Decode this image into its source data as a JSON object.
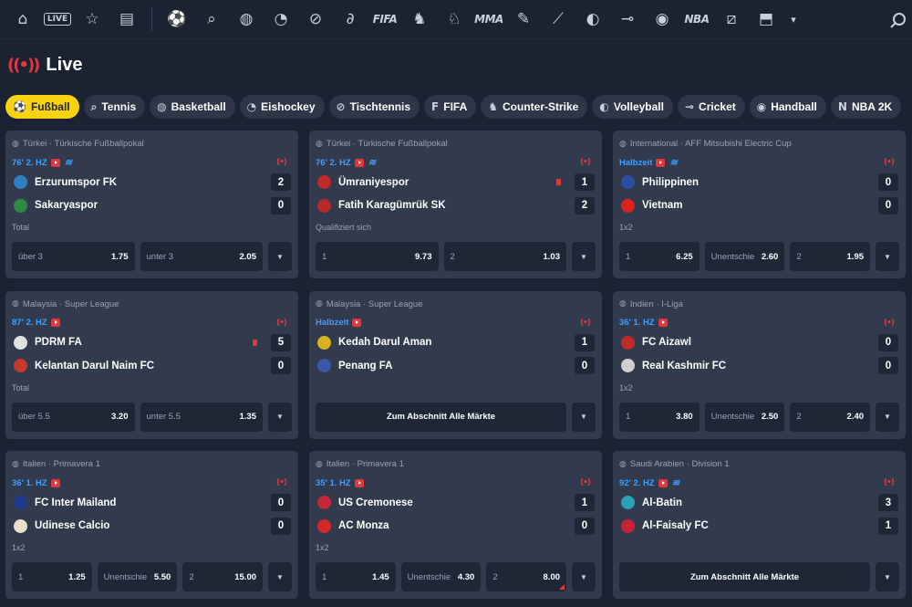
{
  "nav": {
    "items": [
      {
        "name": "home-icon",
        "glyph": "⌂"
      },
      {
        "name": "live-icon",
        "text": "LIVE"
      },
      {
        "name": "star-icon",
        "glyph": "☆"
      },
      {
        "name": "betslip-icon",
        "glyph": "▤"
      },
      {
        "name": "soccer-icon",
        "glyph": "⚽"
      },
      {
        "name": "tennis-icon",
        "glyph": "⌕"
      },
      {
        "name": "basketball-icon",
        "glyph": "◍"
      },
      {
        "name": "ice-hockey-icon",
        "glyph": "◔"
      },
      {
        "name": "table-tennis-icon",
        "glyph": "⊘"
      },
      {
        "name": "hockey-stick-icon",
        "glyph": "∂"
      },
      {
        "name": "fifa-icon",
        "text": "FIFA"
      },
      {
        "name": "counter-strike-icon",
        "glyph": "♞"
      },
      {
        "name": "horse-racing-icon",
        "glyph": "♘"
      },
      {
        "name": "mma-icon",
        "text": "MMA"
      },
      {
        "name": "darts-icon",
        "glyph": "✎"
      },
      {
        "name": "baseball-bat-icon",
        "glyph": "⟋"
      },
      {
        "name": "volleyball-icon",
        "glyph": "◐"
      },
      {
        "name": "badminton-icon",
        "glyph": "⊸"
      },
      {
        "name": "handball-icon",
        "glyph": "◉"
      },
      {
        "name": "nba-2k-icon",
        "text": "NBA"
      },
      {
        "name": "esports-icon",
        "glyph": "⧄"
      },
      {
        "name": "league-icon",
        "glyph": "⬒"
      },
      {
        "name": "more-chevron-icon",
        "glyph": "▾"
      }
    ],
    "search_icon": "search-icon"
  },
  "header": {
    "title": "Live"
  },
  "chips": [
    {
      "label": "Fußball",
      "icon": "soccer-icon",
      "glyph": "⚽",
      "active": true
    },
    {
      "label": "Tennis",
      "icon": "tennis-icon",
      "glyph": "⌕"
    },
    {
      "label": "Basketball",
      "icon": "basketball-icon",
      "glyph": "◍"
    },
    {
      "label": "Eishockey",
      "icon": "ice-hockey-icon",
      "glyph": "◔"
    },
    {
      "label": "Tischtennis",
      "icon": "table-tennis-icon",
      "glyph": "⊘"
    },
    {
      "label": "FIFA",
      "icon": "fifa-icon",
      "glyph": "F"
    },
    {
      "label": "Counter-Strike",
      "icon": "counter-strike-icon",
      "glyph": "♞"
    },
    {
      "label": "Volleyball",
      "icon": "volleyball-icon",
      "glyph": "◐"
    },
    {
      "label": "Cricket",
      "icon": "cricket-icon",
      "glyph": "⊸"
    },
    {
      "label": "Handball",
      "icon": "handball-icon",
      "glyph": "◉"
    },
    {
      "label": "NBA 2K",
      "icon": "nba-2k-icon",
      "glyph": "N"
    }
  ],
  "colors": {
    "accent": "#f7d312",
    "live_red": "#e2383d",
    "time_blue": "#3ea0ff",
    "card_bg": "#323a4d",
    "page_bg": "#1b2232"
  },
  "matches": [
    {
      "league": "Türkei · Türkische Fußballpokal",
      "time": "76' 2. HZ",
      "stats": true,
      "home": {
        "name": "Erzurumspor FK",
        "score": "2",
        "logo": "#2d7fc1"
      },
      "away": {
        "name": "Sakaryaspor",
        "score": "0",
        "logo": "#2f8a45"
      },
      "market": "Total",
      "odds": [
        {
          "label": "über 3",
          "value": "1.75"
        },
        {
          "label": "unter 3",
          "value": "2.05"
        }
      ]
    },
    {
      "league": "Türkei · Türkische Fußballpokal",
      "time": "76' 2. HZ",
      "stats": true,
      "home": {
        "name": "Ümraniyespor",
        "score": "1",
        "logo": "#c0282d",
        "redcard": true
      },
      "away": {
        "name": "Fatih Karagümrük SK",
        "score": "2",
        "logo": "#b52a2a"
      },
      "market": "Qualifiziert sich",
      "odds": [
        {
          "label": "1",
          "value": "9.73"
        },
        {
          "label": "2",
          "value": "1.03"
        }
      ]
    },
    {
      "league": "International · AFF Mitsubishi Electric Cup",
      "time": "Halbzeit",
      "stats": true,
      "home": {
        "name": "Philippinen",
        "score": "0",
        "logo": "#2c4ea3"
      },
      "away": {
        "name": "Vietnam",
        "score": "0",
        "logo": "#d8231f"
      },
      "market": "1x2",
      "odds": [
        {
          "label": "1",
          "value": "6.25"
        },
        {
          "label": "Unentschie",
          "value": "2.60"
        },
        {
          "label": "2",
          "value": "1.95"
        }
      ]
    },
    {
      "league": "Malaysia · Super League",
      "time": "87' 2. HZ",
      "stats": false,
      "home": {
        "name": "PDRM FA",
        "score": "5",
        "logo": "#e0e0e0",
        "redcard": true
      },
      "away": {
        "name": "Kelantan Darul Naim FC",
        "score": "0",
        "logo": "#c43a2b"
      },
      "market": "Total",
      "odds": [
        {
          "label": "über 5.5",
          "value": "3.20"
        },
        {
          "label": "unter 5.5",
          "value": "1.35"
        }
      ]
    },
    {
      "league": "Malaysia · Super League",
      "time": "Halbzeit",
      "stats": false,
      "home": {
        "name": "Kedah Darul Aman",
        "score": "1",
        "logo": "#d9b21f"
      },
      "away": {
        "name": "Penang FA",
        "score": "0",
        "logo": "#3a58a8"
      },
      "market": "",
      "all_markets": "Zum Abschnitt Alle Märkte"
    },
    {
      "league": "Indien · I-Liga",
      "time": "36' 1. HZ",
      "stats": false,
      "home": {
        "name": "FC Aizawl",
        "score": "0",
        "logo": "#c12a2a"
      },
      "away": {
        "name": "Real Kashmir FC",
        "score": "0",
        "logo": "#d0d0d0"
      },
      "market": "1x2",
      "odds": [
        {
          "label": "1",
          "value": "3.80"
        },
        {
          "label": "Unentschie",
          "value": "2.50"
        },
        {
          "label": "2",
          "value": "2.40"
        }
      ]
    },
    {
      "league": "Italien · Primavera 1",
      "time": "36' 1. HZ",
      "stats": false,
      "home": {
        "name": "FC Inter Mailand",
        "score": "0",
        "logo": "#1d3c8c"
      },
      "away": {
        "name": "Udinese Calcio",
        "score": "0",
        "logo": "#e8e0c8"
      },
      "market": "1x2",
      "odds": [
        {
          "label": "1",
          "value": "1.25"
        },
        {
          "label": "Unentschie",
          "value": "5.50"
        },
        {
          "label": "2",
          "value": "15.00"
        }
      ]
    },
    {
      "league": "Italien · Primavera 1",
      "time": "35' 1. HZ",
      "stats": false,
      "home": {
        "name": "US Cremonese",
        "score": "1",
        "logo": "#c6283a"
      },
      "away": {
        "name": "AC Monza",
        "score": "0",
        "logo": "#d22a2a"
      },
      "market": "1x2",
      "odds": [
        {
          "label": "1",
          "value": "1.45"
        },
        {
          "label": "Unentschie",
          "value": "4.30"
        },
        {
          "label": "2",
          "value": "8.00",
          "flag": true
        }
      ]
    },
    {
      "league": "Saudi Arabien · Division 1",
      "time": "92' 2. HZ",
      "stats": true,
      "home": {
        "name": "Al-Batin",
        "score": "3",
        "logo": "#2aa1b8"
      },
      "away": {
        "name": "Al-Faisaly FC",
        "score": "1",
        "logo": "#c62436"
      },
      "market": "",
      "all_markets": "Zum Abschnitt Alle Märkte"
    }
  ]
}
